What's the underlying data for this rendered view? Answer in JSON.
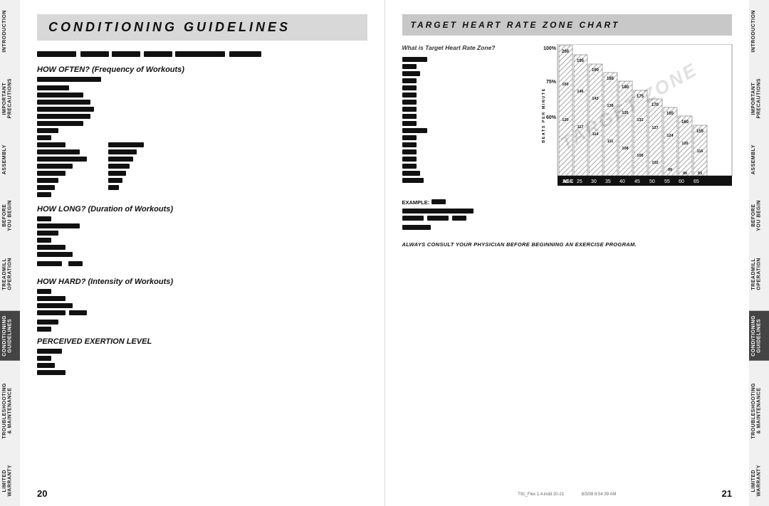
{
  "leftSideTabs": [
    {
      "label": "INTRODUCTION",
      "active": false
    },
    {
      "label": "IMPORTANT PRECAUTIONS",
      "active": false
    },
    {
      "label": "ASSEMBLY",
      "active": false
    },
    {
      "label": "BEFORE YOU BEGIN",
      "active": false
    },
    {
      "label": "TREADMILL OPERATION",
      "active": false
    },
    {
      "label": "CONDITIONING GUIDELINES",
      "active": true
    },
    {
      "label": "TROUBLESHOOTING & MAINTENANCE",
      "active": false
    },
    {
      "label": "LIMITED WARRANTY",
      "active": false
    }
  ],
  "rightSideTabs": [
    {
      "label": "INTRODUCTION",
      "active": false
    },
    {
      "label": "IMPORTANT PRECAUTIONS",
      "active": false
    },
    {
      "label": "ASSEMBLY",
      "active": false
    },
    {
      "label": "BEFORE YOU BEGIN",
      "active": false
    },
    {
      "label": "TREADMILL OPERATION",
      "active": false
    },
    {
      "label": "CONDITIONING GUIDELINES",
      "active": true
    },
    {
      "label": "TROUBLESHOOTING & MAINTENANCE",
      "active": false
    },
    {
      "label": "LIMITED WARRANTY",
      "active": false
    }
  ],
  "leftPage": {
    "title": "CONDITIONING GUIDELINES",
    "pageNumber": "20",
    "sections": [
      {
        "heading": "HOW OFTEN? (Frequency of Workouts)"
      },
      {
        "heading": "HOW LONG? (Duration of Workouts)"
      },
      {
        "heading": "HOW HARD? (Intensity of Workouts)"
      },
      {
        "heading": "PERCEIVED EXERTION LEVEL"
      }
    ]
  },
  "rightPage": {
    "chartTitle": "TARGET HEART RATE ZONE CHART",
    "chartSubtitle": "What is Target Heart Rate Zone?",
    "pageNumber": "21",
    "ageLabels": [
      "20",
      "25",
      "30",
      "35",
      "40",
      "45",
      "50",
      "55",
      "60",
      "65"
    ],
    "percentLabels": [
      "100%",
      "75%",
      "60%"
    ],
    "exampleLabel": "EXAMPLE:",
    "physicianText": "ALWAYS CONSULT YOUR PHYSICIAN BEFORE BEGINNING AN EXERCISE PROGRAM.",
    "fileInfo": "T91_Flex 1.4.indd  20-21",
    "fileDate": "8/3/08  8:54:39 AM"
  }
}
